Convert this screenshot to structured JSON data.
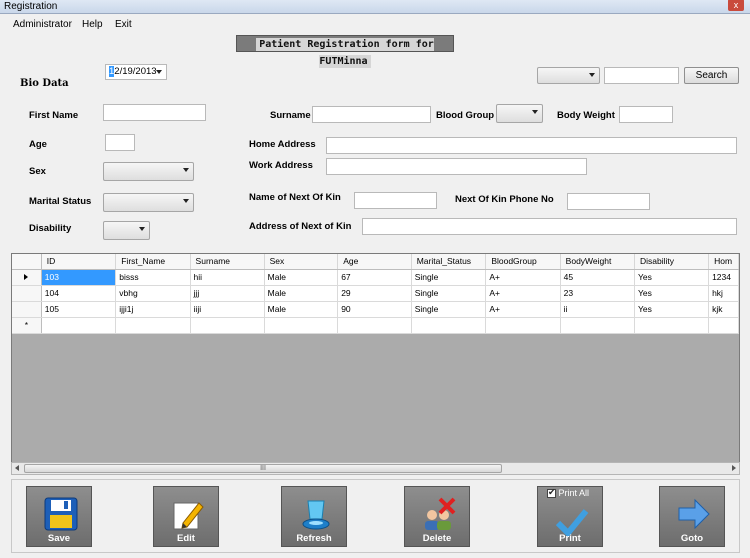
{
  "window": {
    "title": "Registration",
    "close_glyph": "x"
  },
  "menu": [
    "Administrator",
    "Help",
    "Exit"
  ],
  "banner": "Patient Registration form for FUTMinna",
  "date": {
    "selected_part": "1",
    "rest": "2/19/2013"
  },
  "search": {
    "button": "Search",
    "input_value": "",
    "combo_value": ""
  },
  "bio_data": {
    "title": "Bio Data",
    "labels": {
      "first_name": "First Name",
      "age": "Age",
      "sex": "Sex",
      "marital_status": "Marital Status",
      "disability": "Disability",
      "surname": "Surname",
      "blood_group": "Blood Group",
      "body_weight": "Body Weight",
      "home_address": "Home Address",
      "work_address": "Work Address",
      "next_of_kin": "Name of Next Of Kin",
      "kin_phone": "Next Of Kin Phone No",
      "kin_address": "Address of Next of Kin"
    }
  },
  "grid": {
    "columns": [
      "ID",
      "First_Name",
      "Surname",
      "Sex",
      "Age",
      "Marital_Status",
      "BloodGroup",
      "BodyWeight",
      "Disability",
      "Hom"
    ],
    "rows": [
      [
        "103",
        "bisss",
        "hii",
        "Male",
        "67",
        "Single",
        "A+",
        "45",
        "Yes",
        "1234"
      ],
      [
        "104",
        "vbhg",
        "jjj",
        "Male",
        "29",
        "Single",
        "A+",
        "23",
        "Yes",
        "hkj"
      ],
      [
        "105",
        "ijji1j",
        "iiji",
        "Male",
        "90",
        "Single",
        "A+",
        "ii",
        "Yes",
        "kjk"
      ]
    ],
    "new_row_marker": "*",
    "scroll_grip": "III"
  },
  "actions": [
    {
      "label": "Save",
      "icon": "floppy-disk-icon"
    },
    {
      "label": "Edit",
      "icon": "pencil-icon"
    },
    {
      "label": "Refresh",
      "icon": "refresh-icon"
    },
    {
      "label": "Delete",
      "icon": "delete-users-icon"
    },
    {
      "label": "Print",
      "icon": "checkmark-icon"
    },
    {
      "label": "Goto",
      "icon": "arrow-right-icon"
    }
  ],
  "print_all": {
    "label": "Print All",
    "checked": true
  }
}
